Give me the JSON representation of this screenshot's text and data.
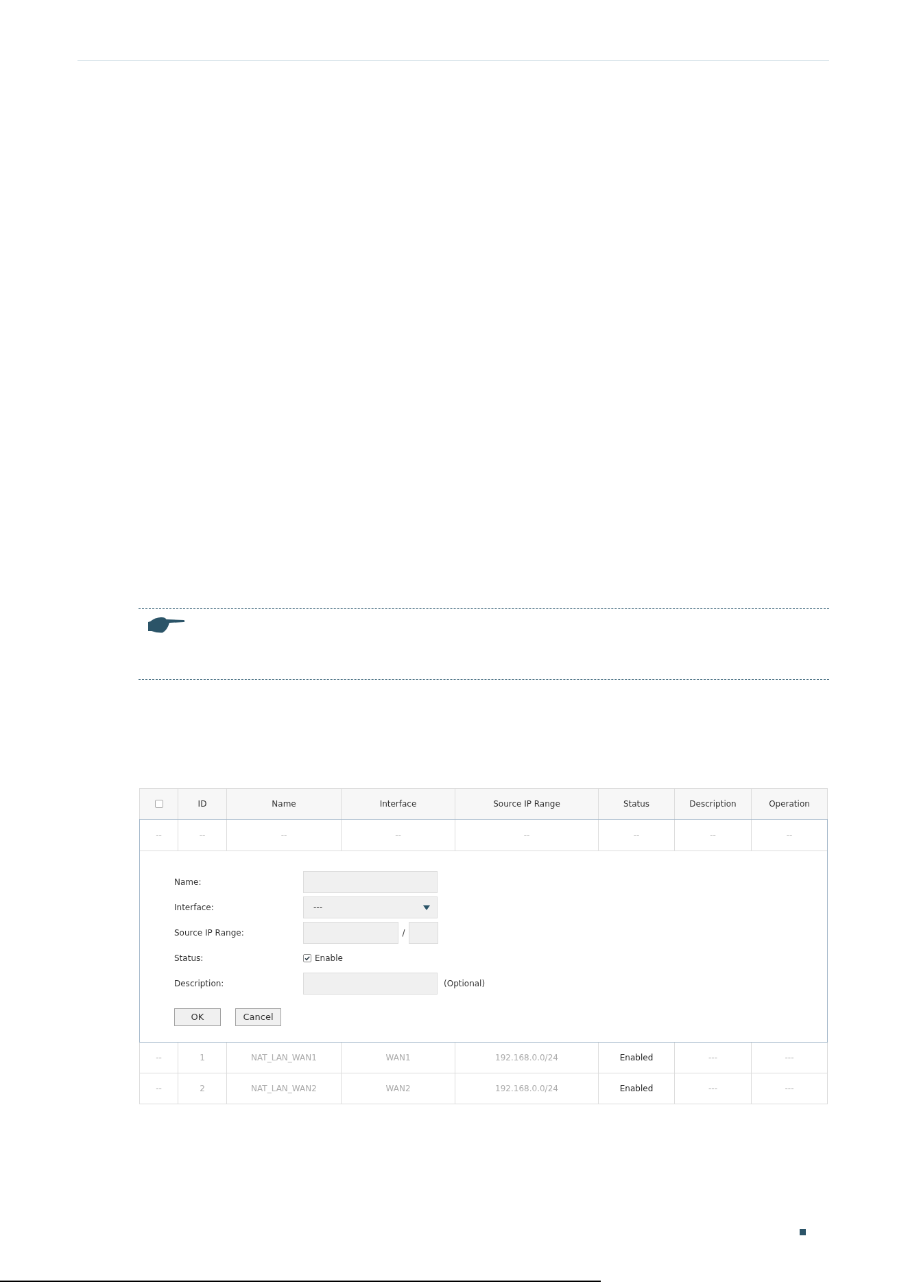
{
  "table": {
    "header": {
      "select_all": {
        "checked": false
      },
      "columns": [
        "ID",
        "Name",
        "Interface",
        "Source IP Range",
        "Status",
        "Description",
        "Operation"
      ]
    },
    "new_entry": {
      "placeholder_row": [
        "--",
        "--",
        "--",
        "--",
        "--",
        "--",
        "--",
        "--"
      ],
      "form": {
        "fields": [
          {
            "kind": "text",
            "label": "Name:"
          },
          {
            "kind": "select",
            "label": "Interface:",
            "value": "---"
          },
          {
            "kind": "ip_range",
            "label": "Source IP Range:",
            "separator": "/"
          },
          {
            "kind": "checkbox",
            "label": "Status:",
            "option": "Enable",
            "checked": true
          },
          {
            "kind": "text",
            "label": "Description:",
            "hint": "(Optional)"
          }
        ],
        "buttons": [
          "OK",
          "Cancel"
        ]
      }
    },
    "rows": [
      {
        "select": "--",
        "id": "1",
        "name": "NAT_LAN_WAN1",
        "interface": "WAN1",
        "source_ip_range": "192.168.0.0/24",
        "status": "Enabled",
        "description": "---",
        "operation": "---"
      },
      {
        "select": "--",
        "id": "2",
        "name": "NAT_LAN_WAN2",
        "interface": "WAN2",
        "source_ip_range": "192.168.0.0/24",
        "status": "Enabled",
        "description": "---",
        "operation": "---"
      }
    ]
  }
}
